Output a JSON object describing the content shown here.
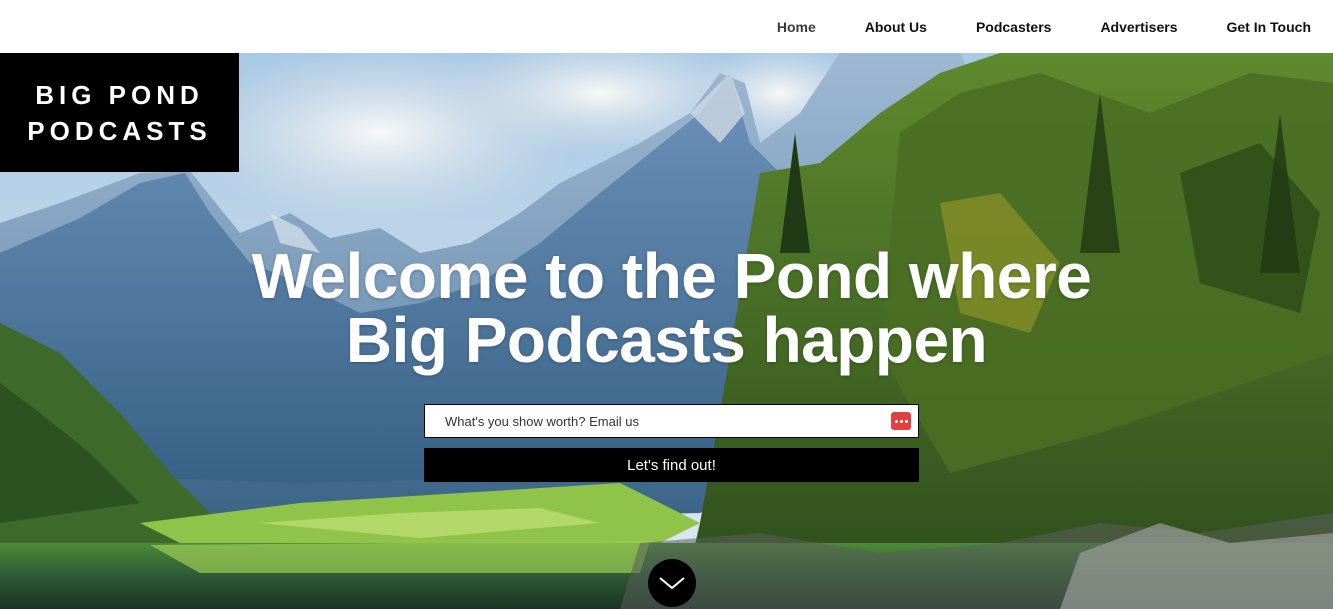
{
  "nav": {
    "items": [
      {
        "label": "Home"
      },
      {
        "label": "About Us"
      },
      {
        "label": "Podcasters"
      },
      {
        "label": "Advertisers"
      },
      {
        "label": "Get In Touch"
      }
    ]
  },
  "logo": {
    "line1": "BIG POND",
    "line2": "PODCASTS"
  },
  "hero": {
    "headline_line1": "Welcome to the Pond where",
    "headline_line2": "Big Podcasts happen",
    "email_placeholder": "What's you show worth? Email us",
    "submit_label": "Let's find out!",
    "scroll_icon": "chevron-down-icon"
  },
  "colors": {
    "nav_background": "#ffffff",
    "logo_background": "#000000",
    "button_background": "#000000",
    "field_icon_accent": "#e0403f"
  }
}
